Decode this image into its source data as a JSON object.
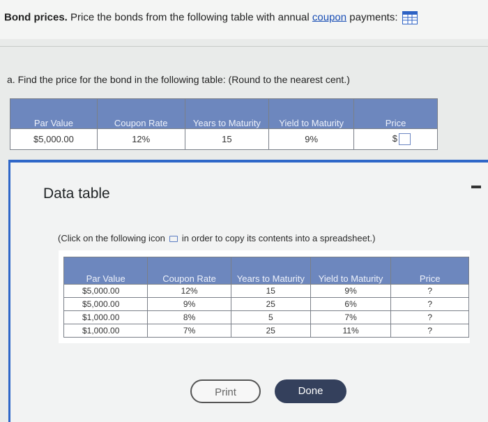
{
  "question": {
    "title_bold": "Bond prices.",
    "title_text_1": " Price the bonds from the following table with annual ",
    "title_link": "coupon",
    "title_text_2": " payments:",
    "part_a": "a. Find the price for the bond in the following table:  (Round to the nearest cent.)"
  },
  "main_table": {
    "headers": [
      "Par Value",
      "Coupon Rate",
      "Years to Maturity",
      "Yield to Maturity",
      "Price"
    ],
    "row": {
      "par_value": "$5,000.00",
      "coupon_rate": "12%",
      "years": "15",
      "yield": "9%",
      "price_prefix": "$",
      "price_value": ""
    }
  },
  "data_table": {
    "title": "Data table",
    "note_before_icon": "(Click on the following icon",
    "note_after_icon": "in order to copy its contents into a spreadsheet.)",
    "headers": [
      "Par Value",
      "Coupon Rate",
      "Years to Maturity",
      "Yield to Maturity",
      "Price"
    ],
    "rows": [
      [
        "$5,000.00",
        "12%",
        "15",
        "9%",
        "?"
      ],
      [
        "$5,000.00",
        "9%",
        "25",
        "6%",
        "?"
      ],
      [
        "$1,000.00",
        "8%",
        "5",
        "7%",
        "?"
      ],
      [
        "$1,000.00",
        "7%",
        "25",
        "11%",
        "?"
      ]
    ],
    "print_label": "Print",
    "done_label": "Done"
  },
  "colors": {
    "header_blue": "#6d87be",
    "panel_border": "#2f67c8",
    "done_button": "#34405c"
  }
}
